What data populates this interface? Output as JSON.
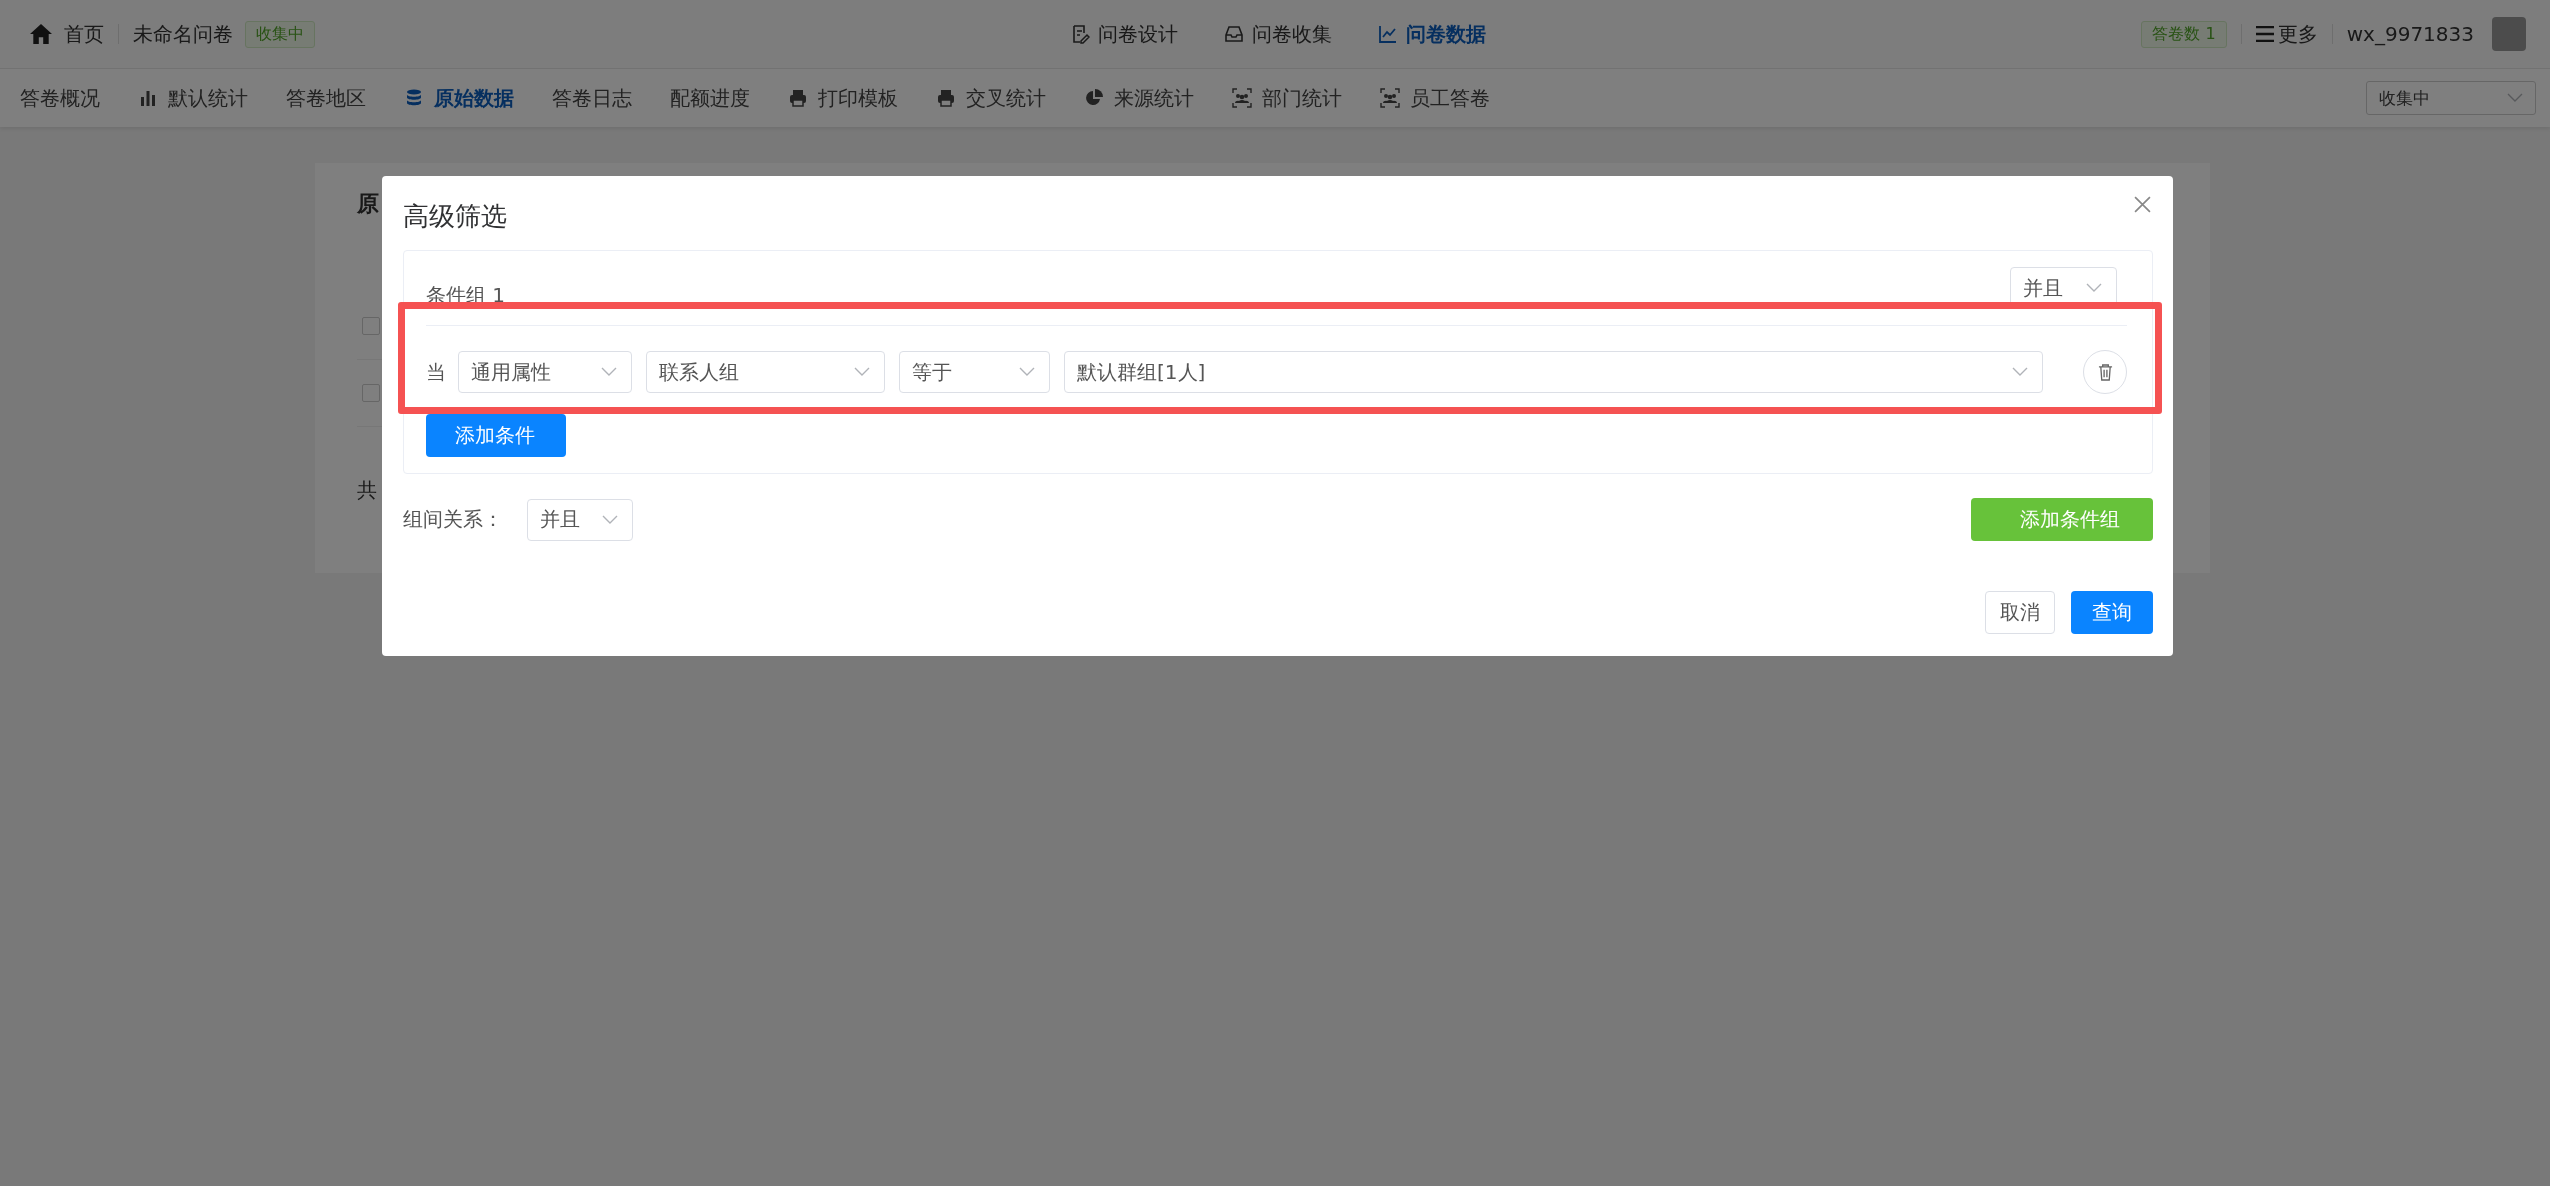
{
  "header": {
    "home": "首页",
    "survey_title": "未命名问卷",
    "status_badge": "收集中",
    "nav": [
      {
        "label": "问卷设计",
        "kind": "design",
        "selected": false
      },
      {
        "label": "问卷收集",
        "kind": "inbox",
        "selected": false
      },
      {
        "label": "问卷数据",
        "kind": "chart",
        "selected": true
      }
    ],
    "answer_count_badge": "答卷数  1",
    "more": "更多",
    "username": "wx_9971833"
  },
  "subnav": {
    "tabs": [
      {
        "label": "答卷概况",
        "kind": "plain",
        "selected": false
      },
      {
        "label": "默认统计",
        "kind": "bars",
        "selected": false
      },
      {
        "label": "答卷地区",
        "kind": "plain",
        "selected": false
      },
      {
        "label": "原始数据",
        "kind": "database",
        "selected": true
      },
      {
        "label": "答卷日志",
        "kind": "plain",
        "selected": false
      },
      {
        "label": "配额进度",
        "kind": "plain",
        "selected": false
      },
      {
        "label": "打印模板",
        "kind": "printer",
        "selected": false
      },
      {
        "label": "交叉统计",
        "kind": "printer",
        "selected": false
      },
      {
        "label": "来源统计",
        "kind": "pie",
        "selected": false
      },
      {
        "label": "部门统计",
        "kind": "people",
        "selected": false
      },
      {
        "label": "员工答卷",
        "kind": "people",
        "selected": false
      }
    ],
    "status_select": "收集中"
  },
  "background_card": {
    "title": "原",
    "rows": [
      {
        "checked": false
      },
      {
        "checked": false
      }
    ],
    "footer": "共"
  },
  "dialog": {
    "title": "高级筛选",
    "groups": [
      {
        "label": "条件组 1",
        "logic": "并且",
        "conditions": [
          {
            "prefix": "当",
            "field_type": "通用属性",
            "field": "联系人组",
            "operator": "等于",
            "value": "默认群组[1人]"
          }
        ],
        "add_condition": "添加条件"
      }
    ],
    "group_relation_label": "组间关系：",
    "group_relation": "并且",
    "add_group": "添加条件组",
    "cancel": "取消",
    "submit": "查询"
  }
}
